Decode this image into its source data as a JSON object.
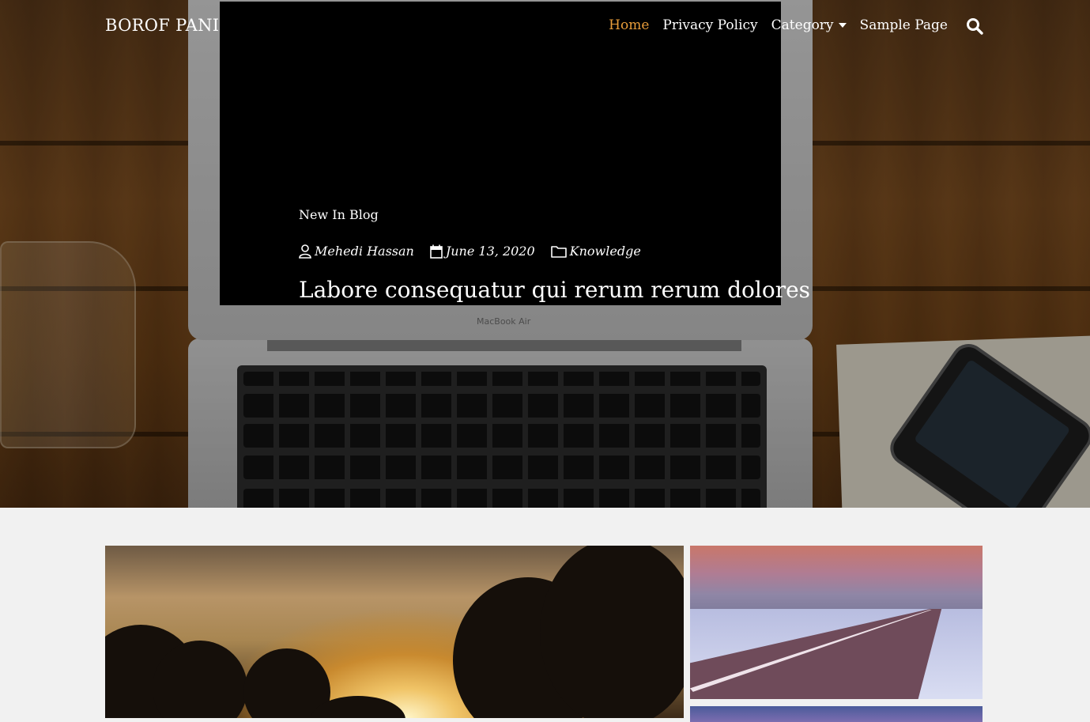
{
  "site": {
    "brand": "BOROF PANI"
  },
  "nav": {
    "items": [
      {
        "label": "Home",
        "active": true
      },
      {
        "label": "Privacy Policy"
      },
      {
        "label": "Category",
        "has_dropdown": true
      },
      {
        "label": "Sample Page"
      }
    ],
    "search_icon": "search-icon"
  },
  "hero": {
    "section_label": "New In Blog",
    "author": "Mehedi Hassan",
    "date": "June 13, 2020",
    "category": "Knowledge",
    "title": "Labore consequatur qui rerum rerum dolores",
    "laptop_brand": "MacBook Air"
  },
  "colors": {
    "accent": "#e89d3a",
    "text_on_hero": "#ffffff",
    "page_bg": "#f1f1f1"
  }
}
